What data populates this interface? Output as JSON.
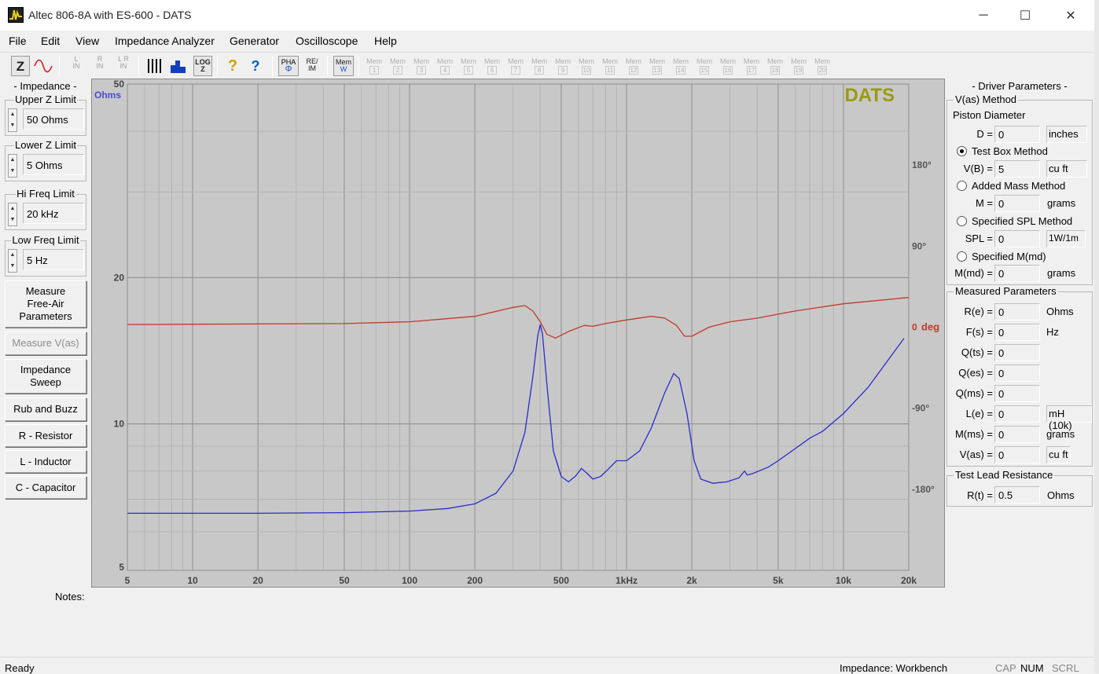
{
  "window": {
    "title": "Altec 806-8A with ES-600 - DATS",
    "minimize_glyph": "─",
    "maximize_glyph": "☐",
    "close_glyph": "✕"
  },
  "menu": [
    "File",
    "Edit",
    "View",
    "Impedance Analyzer",
    "Generator",
    "Oscilloscope",
    "Help"
  ],
  "toolbar": {
    "z_label": "Z",
    "l_in": [
      "L",
      "IN"
    ],
    "r_in": [
      "R",
      "IN"
    ],
    "lr_in": [
      "L R",
      "IN"
    ],
    "log_z": [
      "LOG",
      "Z"
    ],
    "help_glyph": "?",
    "context_help_glyph": "?",
    "pha_label": [
      "PHA",
      "Φ"
    ],
    "reim_label": [
      "RE/",
      "IM"
    ],
    "mem_w": [
      "Mem",
      "W"
    ],
    "mem_slots": [
      "1",
      "2",
      "3",
      "4",
      "5",
      "6",
      "7",
      "8",
      "9",
      "10",
      "11",
      "12",
      "13",
      "14",
      "15",
      "16",
      "17",
      "18",
      "19",
      "20"
    ],
    "mem_prefix": "Mem"
  },
  "left_panel": {
    "section_title": "- Impedance -",
    "upper_z": {
      "label": "Upper Z Limit",
      "value": "50 Ohms"
    },
    "lower_z": {
      "label": "Lower Z Limit",
      "value": "5 Ohms"
    },
    "hi_freq": {
      "label": "Hi Freq Limit",
      "value": "20 kHz"
    },
    "low_freq": {
      "label": "Low Freq Limit",
      "value": "5 Hz"
    },
    "spin_up": "▲",
    "spin_down": "▼",
    "buttons": {
      "measure_free_air": [
        "Measure",
        "Free-Air",
        "Parameters"
      ],
      "measure_vas": "Measure V(as)",
      "impedance_sweep": [
        "Impedance",
        "Sweep"
      ],
      "rub_buzz": "Rub and Buzz",
      "resistor": "R - Resistor",
      "inductor": "L - Inductor",
      "capacitor": "C - Capacitor"
    }
  },
  "chart_data": {
    "type": "line",
    "watermark": "DATS",
    "y_unit_label": "Ohms",
    "x_scale": "log",
    "y_scale": "log",
    "xlim": [
      5,
      20000
    ],
    "ylim": [
      5,
      50
    ],
    "x_ticks": [
      {
        "v": 5,
        "label": "5"
      },
      {
        "v": 10,
        "label": "10"
      },
      {
        "v": 20,
        "label": "20"
      },
      {
        "v": 50,
        "label": "50"
      },
      {
        "v": 100,
        "label": "100"
      },
      {
        "v": 200,
        "label": "200"
      },
      {
        "v": 500,
        "label": "500"
      },
      {
        "v": 1000,
        "label": "1kHz"
      },
      {
        "v": 2000,
        "label": "2k"
      },
      {
        "v": 5000,
        "label": "5k"
      },
      {
        "v": 10000,
        "label": "10k"
      },
      {
        "v": 20000,
        "label": "20k"
      }
    ],
    "y_ticks": [
      {
        "v": 50,
        "label": "50"
      },
      {
        "v": 20,
        "label": "20"
      },
      {
        "v": 10,
        "label": "10"
      },
      {
        "v": 5,
        "label": "5"
      }
    ],
    "phase_axis": {
      "range": [
        -270,
        270
      ],
      "ticks": [
        {
          "v": 180,
          "label": "180°"
        },
        {
          "v": 90,
          "label": "90°"
        },
        {
          "v": 0,
          "label": "0"
        },
        {
          "v": -90,
          "label": "-90°"
        },
        {
          "v": -180,
          "label": "-180°"
        }
      ],
      "unit_label": "deg"
    },
    "grid": true,
    "series": [
      {
        "name": "Impedance",
        "color": "#2b2bcc",
        "points": [
          [
            5,
            6.55
          ],
          [
            20,
            6.55
          ],
          [
            50,
            6.57
          ],
          [
            100,
            6.62
          ],
          [
            150,
            6.7
          ],
          [
            200,
            6.85
          ],
          [
            250,
            7.2
          ],
          [
            300,
            8.0
          ],
          [
            340,
            9.6
          ],
          [
            370,
            12.5
          ],
          [
            390,
            15.2
          ],
          [
            400,
            16.0
          ],
          [
            410,
            15.3
          ],
          [
            430,
            12.0
          ],
          [
            460,
            8.8
          ],
          [
            500,
            7.8
          ],
          [
            540,
            7.6
          ],
          [
            580,
            7.8
          ],
          [
            620,
            8.1
          ],
          [
            660,
            7.9
          ],
          [
            700,
            7.7
          ],
          [
            760,
            7.8
          ],
          [
            830,
            8.1
          ],
          [
            900,
            8.4
          ],
          [
            1000,
            8.4
          ],
          [
            1150,
            8.8
          ],
          [
            1300,
            9.8
          ],
          [
            1500,
            11.6
          ],
          [
            1650,
            12.7
          ],
          [
            1750,
            12.4
          ],
          [
            1900,
            10.5
          ],
          [
            2050,
            8.4
          ],
          [
            2200,
            7.7
          ],
          [
            2500,
            7.55
          ],
          [
            2900,
            7.6
          ],
          [
            3300,
            7.75
          ],
          [
            3500,
            8.0
          ],
          [
            3600,
            7.85
          ],
          [
            3800,
            7.9
          ],
          [
            4500,
            8.15
          ],
          [
            5000,
            8.4
          ],
          [
            6000,
            8.9
          ],
          [
            7000,
            9.35
          ],
          [
            8000,
            9.65
          ],
          [
            10000,
            10.5
          ],
          [
            13000,
            11.9
          ],
          [
            16000,
            13.5
          ],
          [
            19000,
            15.0
          ]
        ]
      },
      {
        "name": "Phase",
        "color": "#c03a2b",
        "points": [
          [
            5,
            3
          ],
          [
            50,
            4
          ],
          [
            100,
            6
          ],
          [
            200,
            12
          ],
          [
            300,
            22
          ],
          [
            340,
            24
          ],
          [
            370,
            18
          ],
          [
            400,
            6
          ],
          [
            430,
            -8
          ],
          [
            470,
            -12
          ],
          [
            550,
            -4
          ],
          [
            640,
            2
          ],
          [
            700,
            1
          ],
          [
            800,
            4
          ],
          [
            1000,
            8
          ],
          [
            1300,
            12
          ],
          [
            1500,
            10
          ],
          [
            1700,
            2
          ],
          [
            1850,
            -10
          ],
          [
            2000,
            -10
          ],
          [
            2400,
            0
          ],
          [
            3000,
            6
          ],
          [
            4000,
            10
          ],
          [
            6000,
            18
          ],
          [
            10000,
            26
          ],
          [
            20000,
            33
          ]
        ]
      }
    ]
  },
  "right_panel": {
    "title": "- Driver Parameters -",
    "vas_method": {
      "legend": "V(as) Method",
      "piston_diameter": "Piston Diameter",
      "d_label": "D =",
      "d_value": "0",
      "d_unit": "inches",
      "test_box": "Test Box Method",
      "vb_label": "V(B) =",
      "vb_value": "5",
      "vb_unit": "cu ft",
      "added_mass": "Added Mass Method",
      "m_label": "M =",
      "m_value": "0",
      "m_unit": "grams",
      "specified_spl": "Specified SPL Method",
      "spl_label": "SPL =",
      "spl_value": "0",
      "spl_unit": "1W/1m",
      "specified_mmd": "Specified M(md)",
      "mmd_label": "M(md) =",
      "mmd_value": "0",
      "mmd_unit": "grams"
    },
    "measured": {
      "legend": "Measured Parameters",
      "rows": [
        {
          "label": "R(e) =",
          "value": "0",
          "unit": "Ohms"
        },
        {
          "label": "F(s) =",
          "value": "0",
          "unit": "Hz"
        },
        {
          "label": "Q(ts) =",
          "value": "0",
          "unit": ""
        },
        {
          "label": "Q(es) =",
          "value": "0",
          "unit": ""
        },
        {
          "label": "Q(ms) =",
          "value": "0",
          "unit": ""
        },
        {
          "label": "L(e) =",
          "value": "0",
          "unit": "mH (10k)"
        },
        {
          "label": "M(ms) =",
          "value": "0",
          "unit": "grams"
        },
        {
          "label": "V(as) =",
          "value": "0",
          "unit": "cu ft"
        }
      ]
    },
    "test_lead": {
      "legend": "Test Lead Resistance",
      "label": "R(t) =",
      "value": "0.5",
      "unit": "Ohms"
    }
  },
  "notes_label": "Notes:",
  "status": {
    "left": "Ready",
    "mode": "Impedance: Workbench",
    "cap": "CAP",
    "num": "NUM",
    "scrl": "SCRL"
  },
  "colors": {
    "impedance": "#2b2bcc",
    "phase": "#c03a2b",
    "watermark": "#9a9a10",
    "plot_bg": "#c8c8c8"
  }
}
